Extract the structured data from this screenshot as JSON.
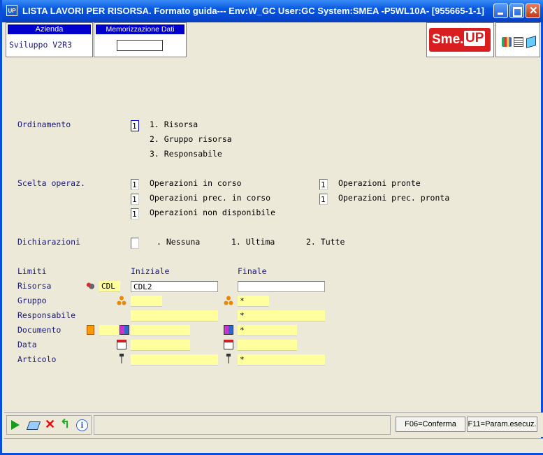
{
  "window": {
    "app_icon": "UP",
    "title": "LISTA LAVORI PER RISORSA.  Formato guida--- Env:W_GC User:GC System:SMEA -P5WL10A- [955665-1-1]"
  },
  "header": {
    "azienda_label": "Azienda",
    "azienda_value": "Sviluppo V2R3",
    "memo_label": "Memorizzazione Dati Video",
    "memo_value": "",
    "logo_left": "Sme.",
    "logo_right": "UP"
  },
  "form": {
    "ordinamento": {
      "label": "Ordinamento",
      "value": "1",
      "options": [
        "1. Risorsa",
        "2. Gruppo risorsa",
        "3. Responsabile"
      ]
    },
    "scelta": {
      "label": "Scelta operaz.",
      "items": [
        {
          "value": "1",
          "label": "Operazioni in corso"
        },
        {
          "value": "1",
          "label": "Operazioni prec. in corso"
        },
        {
          "value": "1",
          "label": "Operazioni non disponibile"
        },
        {
          "value": "1",
          "label": "Operazioni pronte"
        },
        {
          "value": "1",
          "label": "Operazioni prec. pronta"
        }
      ]
    },
    "dichiarazioni": {
      "label": "Dichiarazioni",
      "value": "",
      "options": [
        ". Nessuna",
        "1. Ultima",
        "2. Tutte"
      ]
    },
    "limiti": {
      "label": "Limiti",
      "col_iniziale": "Iniziale",
      "col_finale": "Finale",
      "rows": [
        {
          "label": "Risorsa",
          "prefix": "CDL",
          "iniziale": "CDL2",
          "finale": ""
        },
        {
          "label": "Gruppo",
          "iniziale": "",
          "finale": "*"
        },
        {
          "label": "Responsabile",
          "iniziale": "",
          "finale": "*"
        },
        {
          "label": "Documento",
          "prefix": "",
          "iniziale": "",
          "finale": "*"
        },
        {
          "label": "Data",
          "iniziale": "",
          "finale": ""
        },
        {
          "label": "Articolo",
          "iniziale": "",
          "finale": "*"
        }
      ]
    }
  },
  "functions": {
    "f06": "F06=Conferma",
    "f11": "F11=Param.esecuz."
  },
  "colors": {
    "label_navy": "#1a1a7a",
    "field_yellow": "#ffff9e",
    "title_blue": "#0858e0"
  }
}
